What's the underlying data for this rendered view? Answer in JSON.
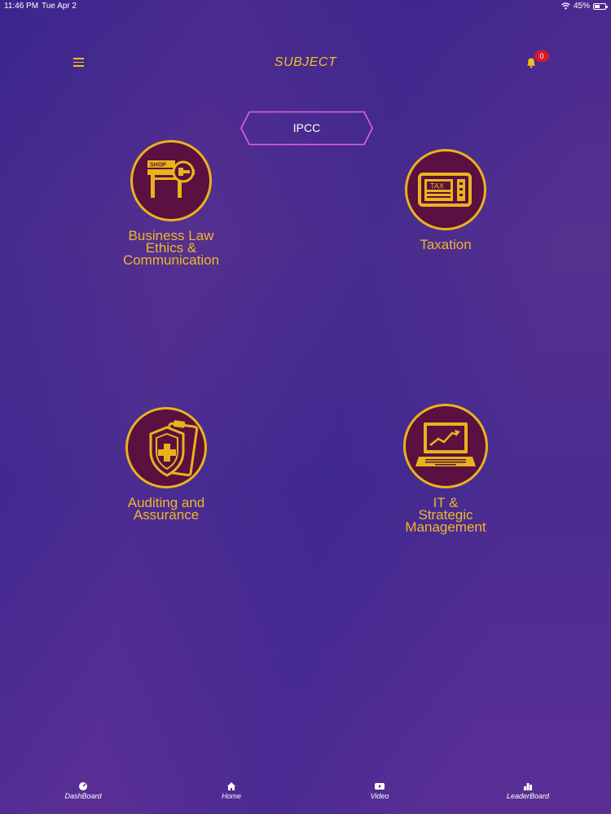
{
  "status_bar": {
    "time": "11:46 PM",
    "date": "Tue Apr 2",
    "battery": "45%"
  },
  "header": {
    "title": "SUBJECT",
    "notification_count": "0"
  },
  "tab": {
    "label": "IPCC"
  },
  "subjects": [
    {
      "label": "Business Law\nEthics &\nCommunication",
      "icon": "shop-icon"
    },
    {
      "label": "Taxation",
      "icon": "tax-icon"
    },
    {
      "label": "Auditing and\nAssurance",
      "icon": "shield-clipboard-icon"
    },
    {
      "label": "IT &\nStrategic\nManagement",
      "icon": "laptop-chart-icon"
    }
  ],
  "bottom_nav": [
    {
      "label": "DashBoard",
      "icon": "dashboard-icon"
    },
    {
      "label": "Home",
      "icon": "home-icon"
    },
    {
      "label": "Video",
      "icon": "video-icon"
    },
    {
      "label": "LeaderBoard",
      "icon": "leaderboard-icon"
    }
  ],
  "colors": {
    "accent": "#f0b62a",
    "icon_background": "#5a1040",
    "tab_border": "#e060f0",
    "badge": "#d8182a"
  }
}
